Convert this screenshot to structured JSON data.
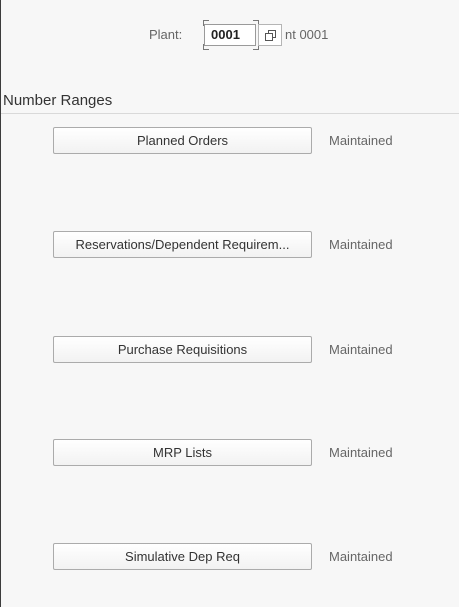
{
  "header": {
    "plant_label": "Plant:",
    "plant_value": "0001",
    "plant_description": "nt 0001"
  },
  "section": {
    "title": "Number Ranges"
  },
  "number_ranges": [
    {
      "label": "Planned Orders",
      "status": "Maintained"
    },
    {
      "label": "Reservations/Dependent Requirem...",
      "status": "Maintained"
    },
    {
      "label": "Purchase Requisitions",
      "status": "Maintained"
    },
    {
      "label": "MRP Lists",
      "status": "Maintained"
    },
    {
      "label": "Simulative Dep Req",
      "status": "Maintained"
    }
  ],
  "icons": {
    "value_help": "copy-icon"
  },
  "colors": {
    "background": "#f7f7f7",
    "button_border": "#ababab",
    "text_muted": "#666666"
  }
}
